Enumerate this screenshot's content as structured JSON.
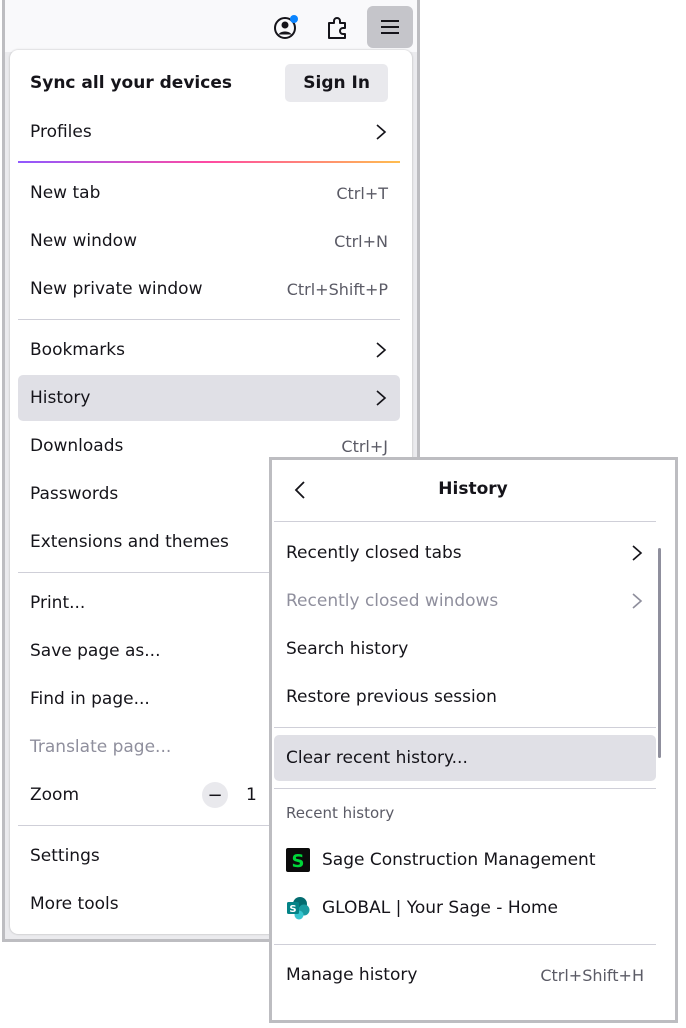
{
  "colors": {
    "accent_highlight": "#e0e0e6",
    "separator_gradient": [
      "#9059ff",
      "#ff4aa2",
      "#ffbd4f"
    ],
    "disabled_text": "#8f8f9d",
    "notification_dot": "#0a84ff"
  },
  "toolbar": {
    "icons": [
      "account-icon",
      "extensions-icon",
      "hamburger-menu-icon"
    ]
  },
  "app_menu": {
    "sync": {
      "title": "Sync all your devices",
      "sign_in": "Sign In"
    },
    "profiles": "Profiles",
    "new_tab": {
      "label": "New tab",
      "shortcut": "Ctrl+T"
    },
    "new_window": {
      "label": "New window",
      "shortcut": "Ctrl+N"
    },
    "new_private_window": {
      "label": "New private window",
      "shortcut": "Ctrl+Shift+P"
    },
    "bookmarks": "Bookmarks",
    "history": "History",
    "downloads": {
      "label": "Downloads",
      "shortcut": "Ctrl+J"
    },
    "passwords": "Passwords",
    "extensions_themes": "Extensions and themes",
    "print": "Print...",
    "save_page": "Save page as...",
    "find_in_page": "Find in page...",
    "translate_page": "Translate page...",
    "zoom": {
      "label": "Zoom",
      "minus": "−",
      "value_partial": "1"
    },
    "settings": "Settings",
    "more_tools": "More tools"
  },
  "history_panel": {
    "title": "History",
    "recently_closed_tabs": "Recently closed tabs",
    "recently_closed_windows": "Recently closed windows",
    "search_history": "Search history",
    "restore_session": "Restore previous session",
    "clear_recent": "Clear recent history...",
    "recent_history_label": "Recent history",
    "recent_items": [
      {
        "title": "Sage Construction Management",
        "icon": "sage-construction-favicon-icon"
      },
      {
        "title": "GLOBAL | Your Sage - Home",
        "icon": "sharepoint-favicon-icon"
      }
    ],
    "manage_history": {
      "label": "Manage history",
      "shortcut": "Ctrl+Shift+H"
    }
  }
}
